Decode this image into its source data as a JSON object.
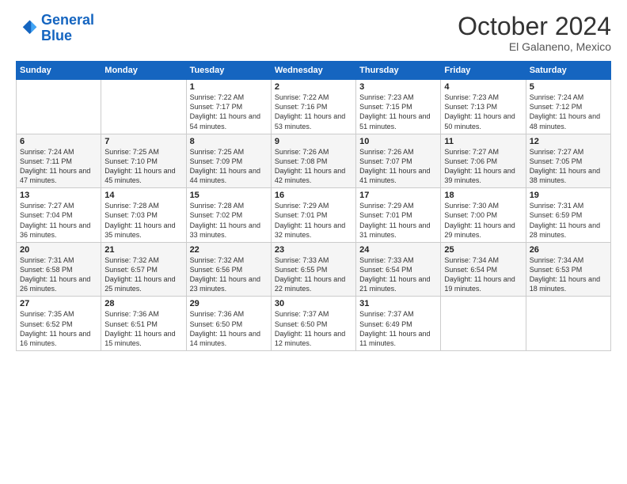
{
  "logo": {
    "line1": "General",
    "line2": "Blue"
  },
  "title": "October 2024",
  "location": "El Galaneno, Mexico",
  "weekdays": [
    "Sunday",
    "Monday",
    "Tuesday",
    "Wednesday",
    "Thursday",
    "Friday",
    "Saturday"
  ],
  "weeks": [
    [
      {
        "day": "",
        "info": ""
      },
      {
        "day": "",
        "info": ""
      },
      {
        "day": "1",
        "info": "Sunrise: 7:22 AM\nSunset: 7:17 PM\nDaylight: 11 hours\nand 54 minutes."
      },
      {
        "day": "2",
        "info": "Sunrise: 7:22 AM\nSunset: 7:16 PM\nDaylight: 11 hours\nand 53 minutes."
      },
      {
        "day": "3",
        "info": "Sunrise: 7:23 AM\nSunset: 7:15 PM\nDaylight: 11 hours\nand 51 minutes."
      },
      {
        "day": "4",
        "info": "Sunrise: 7:23 AM\nSunset: 7:13 PM\nDaylight: 11 hours\nand 50 minutes."
      },
      {
        "day": "5",
        "info": "Sunrise: 7:24 AM\nSunset: 7:12 PM\nDaylight: 11 hours\nand 48 minutes."
      }
    ],
    [
      {
        "day": "6",
        "info": "Sunrise: 7:24 AM\nSunset: 7:11 PM\nDaylight: 11 hours\nand 47 minutes."
      },
      {
        "day": "7",
        "info": "Sunrise: 7:25 AM\nSunset: 7:10 PM\nDaylight: 11 hours\nand 45 minutes."
      },
      {
        "day": "8",
        "info": "Sunrise: 7:25 AM\nSunset: 7:09 PM\nDaylight: 11 hours\nand 44 minutes."
      },
      {
        "day": "9",
        "info": "Sunrise: 7:26 AM\nSunset: 7:08 PM\nDaylight: 11 hours\nand 42 minutes."
      },
      {
        "day": "10",
        "info": "Sunrise: 7:26 AM\nSunset: 7:07 PM\nDaylight: 11 hours\nand 41 minutes."
      },
      {
        "day": "11",
        "info": "Sunrise: 7:27 AM\nSunset: 7:06 PM\nDaylight: 11 hours\nand 39 minutes."
      },
      {
        "day": "12",
        "info": "Sunrise: 7:27 AM\nSunset: 7:05 PM\nDaylight: 11 hours\nand 38 minutes."
      }
    ],
    [
      {
        "day": "13",
        "info": "Sunrise: 7:27 AM\nSunset: 7:04 PM\nDaylight: 11 hours\nand 36 minutes."
      },
      {
        "day": "14",
        "info": "Sunrise: 7:28 AM\nSunset: 7:03 PM\nDaylight: 11 hours\nand 35 minutes."
      },
      {
        "day": "15",
        "info": "Sunrise: 7:28 AM\nSunset: 7:02 PM\nDaylight: 11 hours\nand 33 minutes."
      },
      {
        "day": "16",
        "info": "Sunrise: 7:29 AM\nSunset: 7:01 PM\nDaylight: 11 hours\nand 32 minutes."
      },
      {
        "day": "17",
        "info": "Sunrise: 7:29 AM\nSunset: 7:01 PM\nDaylight: 11 hours\nand 31 minutes."
      },
      {
        "day": "18",
        "info": "Sunrise: 7:30 AM\nSunset: 7:00 PM\nDaylight: 11 hours\nand 29 minutes."
      },
      {
        "day": "19",
        "info": "Sunrise: 7:31 AM\nSunset: 6:59 PM\nDaylight: 11 hours\nand 28 minutes."
      }
    ],
    [
      {
        "day": "20",
        "info": "Sunrise: 7:31 AM\nSunset: 6:58 PM\nDaylight: 11 hours\nand 26 minutes."
      },
      {
        "day": "21",
        "info": "Sunrise: 7:32 AM\nSunset: 6:57 PM\nDaylight: 11 hours\nand 25 minutes."
      },
      {
        "day": "22",
        "info": "Sunrise: 7:32 AM\nSunset: 6:56 PM\nDaylight: 11 hours\nand 23 minutes."
      },
      {
        "day": "23",
        "info": "Sunrise: 7:33 AM\nSunset: 6:55 PM\nDaylight: 11 hours\nand 22 minutes."
      },
      {
        "day": "24",
        "info": "Sunrise: 7:33 AM\nSunset: 6:54 PM\nDaylight: 11 hours\nand 21 minutes."
      },
      {
        "day": "25",
        "info": "Sunrise: 7:34 AM\nSunset: 6:54 PM\nDaylight: 11 hours\nand 19 minutes."
      },
      {
        "day": "26",
        "info": "Sunrise: 7:34 AM\nSunset: 6:53 PM\nDaylight: 11 hours\nand 18 minutes."
      }
    ],
    [
      {
        "day": "27",
        "info": "Sunrise: 7:35 AM\nSunset: 6:52 PM\nDaylight: 11 hours\nand 16 minutes."
      },
      {
        "day": "28",
        "info": "Sunrise: 7:36 AM\nSunset: 6:51 PM\nDaylight: 11 hours\nand 15 minutes."
      },
      {
        "day": "29",
        "info": "Sunrise: 7:36 AM\nSunset: 6:50 PM\nDaylight: 11 hours\nand 14 minutes."
      },
      {
        "day": "30",
        "info": "Sunrise: 7:37 AM\nSunset: 6:50 PM\nDaylight: 11 hours\nand 12 minutes."
      },
      {
        "day": "31",
        "info": "Sunrise: 7:37 AM\nSunset: 6:49 PM\nDaylight: 11 hours\nand 11 minutes."
      },
      {
        "day": "",
        "info": ""
      },
      {
        "day": "",
        "info": ""
      }
    ]
  ]
}
